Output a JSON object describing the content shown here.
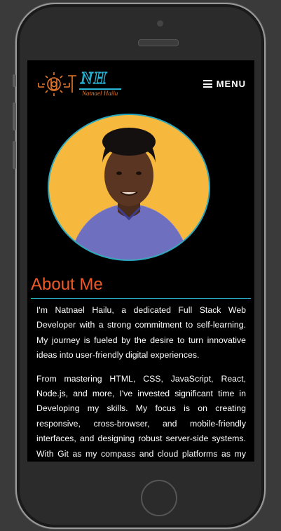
{
  "logo": {
    "initials": "NH",
    "name": "Natnael Hailu"
  },
  "nav": {
    "menu_label": "MENU"
  },
  "about": {
    "title": "About Me",
    "paragraphs": [
      "I'm Natnael Hailu, a dedicated Full Stack Web Developer with a strong commitment to self-learning. My journey is fueled by the desire to turn innovative ideas into user-friendly digital experiences.",
      "From mastering HTML, CSS, JavaScript, React, Node.js, and more, I've invested significant time in Developing my skills. My focus is on creating responsive, cross-browser, and mobile-friendly interfaces, and designing robust server-side systems. With Git as my compass and cloud platforms as my launchpad, I'm on a mission to excel in"
    ]
  },
  "colors": {
    "accent_orange": "#f05a28",
    "accent_teal": "#2aa8c0",
    "avatar_bg": "#f7b83e"
  }
}
